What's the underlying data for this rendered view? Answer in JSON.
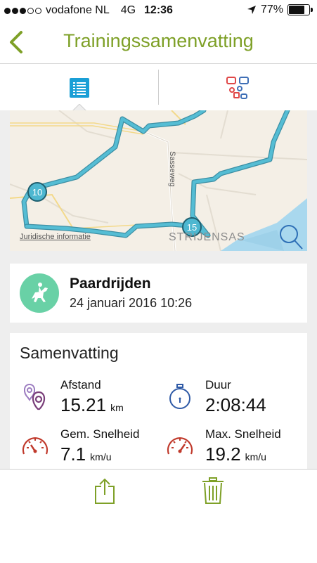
{
  "status_bar": {
    "carrier": "vodafone NL",
    "network": "4G",
    "time": "12:36",
    "battery_percent": "77%",
    "battery_level": 0.77
  },
  "nav": {
    "title": "Trainingssamenvatting",
    "back_icon": "chevron-left-icon"
  },
  "tabs": [
    {
      "icon": "list-icon",
      "active": true
    },
    {
      "icon": "map-pins-icon",
      "active": false
    }
  ],
  "map": {
    "legal_label": "Juridische informatie",
    "street_label": "Sasseweg",
    "place_label": "STRIJENSAS",
    "markers": [
      "10",
      "15"
    ],
    "route_color": "#4db7d0"
  },
  "activity": {
    "name": "Paardrijden",
    "date": "24 januari 2016 10:26",
    "icon": "horse-riding-icon",
    "icon_color": "#69d1a6"
  },
  "summary": {
    "heading": "Samenvatting",
    "stats": [
      {
        "label": "Afstand",
        "value": "15.21",
        "unit": "km",
        "icon": "location-pins-icon"
      },
      {
        "label": "Duur",
        "value": "2:08:44",
        "unit": "",
        "icon": "stopwatch-icon"
      },
      {
        "label": "Gem. Snelheid",
        "value": "7.1",
        "unit": "km/u",
        "icon": "speedometer-icon"
      },
      {
        "label": "Max. Snelheid",
        "value": "19.2",
        "unit": "km/u",
        "icon": "speedometer-max-icon"
      }
    ]
  },
  "toolbar": {
    "share_icon": "share-icon",
    "delete_icon": "trash-icon"
  },
  "colors": {
    "accent": "#7ea027",
    "tab_active": "#1a9fd6"
  }
}
